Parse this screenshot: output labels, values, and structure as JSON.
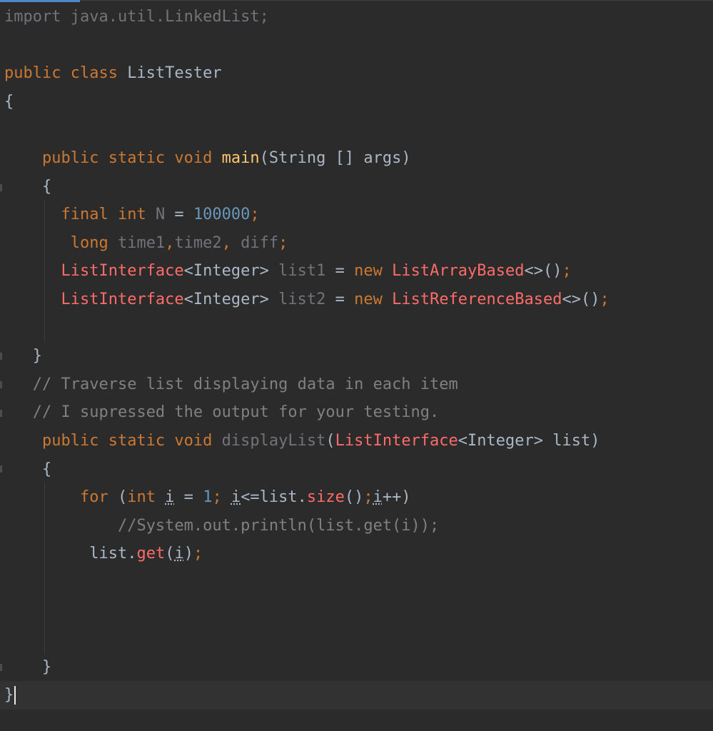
{
  "editor": {
    "lines": [
      [
        {
          "t": "import java.util.LinkedList;",
          "c": "unused"
        }
      ],
      [],
      [
        {
          "t": "public class ",
          "c": "kw"
        },
        {
          "t": "ListTester",
          "c": "plain"
        }
      ],
      [
        {
          "t": "{",
          "c": "plain"
        }
      ],
      [],
      [
        {
          "t": "    "
        },
        {
          "t": "public static void ",
          "c": "kw"
        },
        {
          "t": "main",
          "c": "fn"
        },
        {
          "t": "(String [] args)",
          "c": "plain"
        }
      ],
      [
        {
          "t": "    {",
          "c": "plain"
        }
      ],
      [
        {
          "t": "      "
        },
        {
          "t": "final int ",
          "c": "kw"
        },
        {
          "t": "N",
          "c": "unused"
        },
        {
          "t": " = ",
          "c": "plain"
        },
        {
          "t": "100000",
          "c": "num"
        },
        {
          "t": ";",
          "c": "kw"
        }
      ],
      [
        {
          "t": "       "
        },
        {
          "t": "long ",
          "c": "kw"
        },
        {
          "t": "time1",
          "c": "unused"
        },
        {
          "t": ",",
          "c": "kw"
        },
        {
          "t": "time2",
          "c": "unused"
        },
        {
          "t": ", ",
          "c": "kw"
        },
        {
          "t": "diff",
          "c": "unused"
        },
        {
          "t": ";",
          "c": "kw"
        }
      ],
      [
        {
          "t": "      "
        },
        {
          "t": "ListInterface",
          "c": "red"
        },
        {
          "t": "<Integer> ",
          "c": "plain"
        },
        {
          "t": "list1",
          "c": "unused"
        },
        {
          "t": " = ",
          "c": "plain"
        },
        {
          "t": "new ",
          "c": "kw"
        },
        {
          "t": "ListArrayBased",
          "c": "red"
        },
        {
          "t": "<>()",
          "c": "plain"
        },
        {
          "t": ";",
          "c": "kw"
        }
      ],
      [
        {
          "t": "      "
        },
        {
          "t": "ListInterface",
          "c": "red"
        },
        {
          "t": "<Integer> ",
          "c": "plain"
        },
        {
          "t": "list2",
          "c": "unused"
        },
        {
          "t": " = ",
          "c": "plain"
        },
        {
          "t": "new ",
          "c": "kw"
        },
        {
          "t": "ListReferenceBased",
          "c": "red"
        },
        {
          "t": "<>()",
          "c": "plain"
        },
        {
          "t": ";",
          "c": "kw"
        }
      ],
      [],
      [
        {
          "t": "   }",
          "c": "plain"
        }
      ],
      [
        {
          "t": "   "
        },
        {
          "t": "// Traverse list displaying data in each item",
          "c": "cmt"
        }
      ],
      [
        {
          "t": "   "
        },
        {
          "t": "// I supressed the output for your testing.",
          "c": "cmt"
        }
      ],
      [
        {
          "t": "    "
        },
        {
          "t": "public static void ",
          "c": "kw"
        },
        {
          "t": "displayList",
          "c": "unused"
        },
        {
          "t": "(",
          "c": "plain"
        },
        {
          "t": "ListInterface",
          "c": "red"
        },
        {
          "t": "<Integer> list)",
          "c": "plain"
        }
      ],
      [
        {
          "t": "    {",
          "c": "plain"
        }
      ],
      [
        {
          "t": "        "
        },
        {
          "t": "for ",
          "c": "kw"
        },
        {
          "t": "(",
          "c": "plain"
        },
        {
          "t": "int ",
          "c": "kw"
        },
        {
          "t": "i",
          "c": "plain",
          "u": true
        },
        {
          "t": " = ",
          "c": "plain"
        },
        {
          "t": "1",
          "c": "num"
        },
        {
          "t": "; ",
          "c": "kw"
        },
        {
          "t": "i",
          "c": "plain",
          "u": true
        },
        {
          "t": "<=list.",
          "c": "plain"
        },
        {
          "t": "size",
          "c": "method-call"
        },
        {
          "t": "()",
          "c": "plain"
        },
        {
          "t": ";",
          "c": "kw"
        },
        {
          "t": "i",
          "c": "plain",
          "u": true
        },
        {
          "t": "++)",
          "c": "plain"
        }
      ],
      [
        {
          "t": "            "
        },
        {
          "t": "//System.out.println(list.get(i));",
          "c": "cmt"
        }
      ],
      [
        {
          "t": "         "
        },
        {
          "t": "list.",
          "c": "plain"
        },
        {
          "t": "get",
          "c": "method-call"
        },
        {
          "t": "(",
          "c": "plain"
        },
        {
          "t": "i",
          "c": "plain",
          "u": true
        },
        {
          "t": ")",
          "c": "plain"
        },
        {
          "t": ";",
          "c": "kw"
        }
      ],
      [],
      [],
      [],
      [
        {
          "t": "    }",
          "c": "plain"
        }
      ],
      [
        {
          "t": "}",
          "c": "plain"
        }
      ]
    ]
  }
}
